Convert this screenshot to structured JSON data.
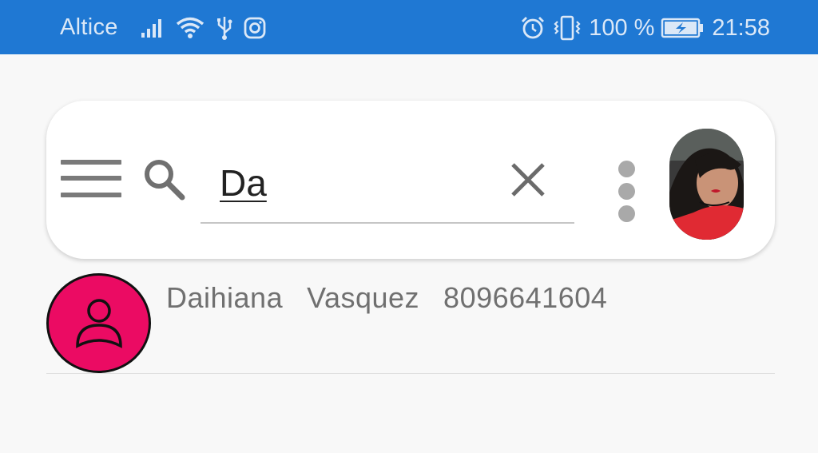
{
  "status_bar": {
    "carrier": "Altice",
    "battery_level": "100 %",
    "time": "21:58",
    "icons": [
      "signal-icon",
      "wifi-icon",
      "usb-icon",
      "instagram-icon",
      "alarm-icon",
      "vibrate-icon",
      "battery-charging-icon"
    ]
  },
  "search": {
    "query": "Da",
    "icons": [
      "menu-icon",
      "search-icon",
      "clear-icon",
      "more-vert-icon"
    ]
  },
  "results": [
    {
      "first_name": "Daihiana",
      "last_name": "Vasquez",
      "phone": "8096641604",
      "avatar_color": "#eb0b63"
    }
  ],
  "colors": {
    "status_bar": "#1f78d3",
    "background": "#f8f8f8",
    "avatar": "#eb0b63"
  }
}
